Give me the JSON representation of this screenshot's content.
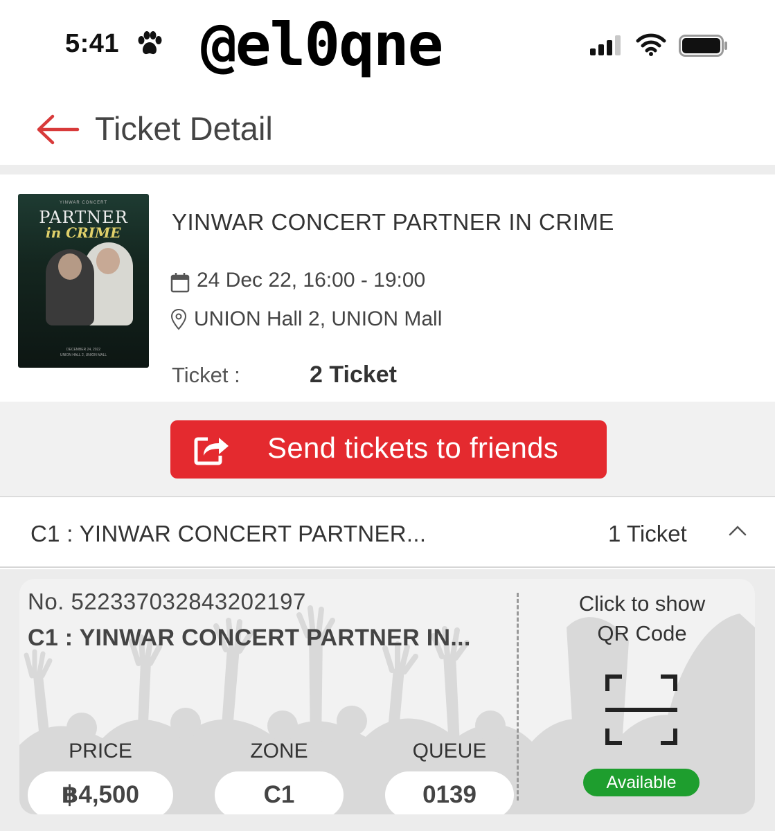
{
  "status_bar": {
    "time": "5:41",
    "watermark": "@el0qne"
  },
  "header": {
    "title": "Ticket Detail"
  },
  "event": {
    "title": "YINWAR CONCERT PARTNER IN CRIME",
    "datetime": "24 Dec 22, 16:00 - 19:00",
    "location": "UNION Hall 2, UNION Mall",
    "ticket_label": "Ticket :",
    "ticket_count": "2 Ticket",
    "poster": {
      "top_line": "YINWAR CONCERT",
      "title": "PARTNER",
      "subtitle": "in CRIME",
      "date_line": "DECEMBER 24, 2022",
      "venue_line": "UNION HALL 2, UNION MALL"
    }
  },
  "send_button": {
    "label": "Send tickets to friends"
  },
  "accordion": {
    "title": "C1 : YINWAR CONCERT PARTNER...",
    "count": "1 Ticket"
  },
  "ticket": {
    "number": "No. 522337032843202197",
    "name": "C1 : YINWAR CONCERT PARTNER IN...",
    "price_label": "PRICE",
    "price_value": "฿4,500",
    "zone_label": "ZONE",
    "zone_value": "C1",
    "queue_label": "QUEUE",
    "queue_value": "0139",
    "qr_text_line1": "Click to show",
    "qr_text_line2": "QR Code",
    "status": "Available"
  },
  "colors": {
    "accent_red": "#e42a2f",
    "status_green": "#1e9e2e"
  }
}
